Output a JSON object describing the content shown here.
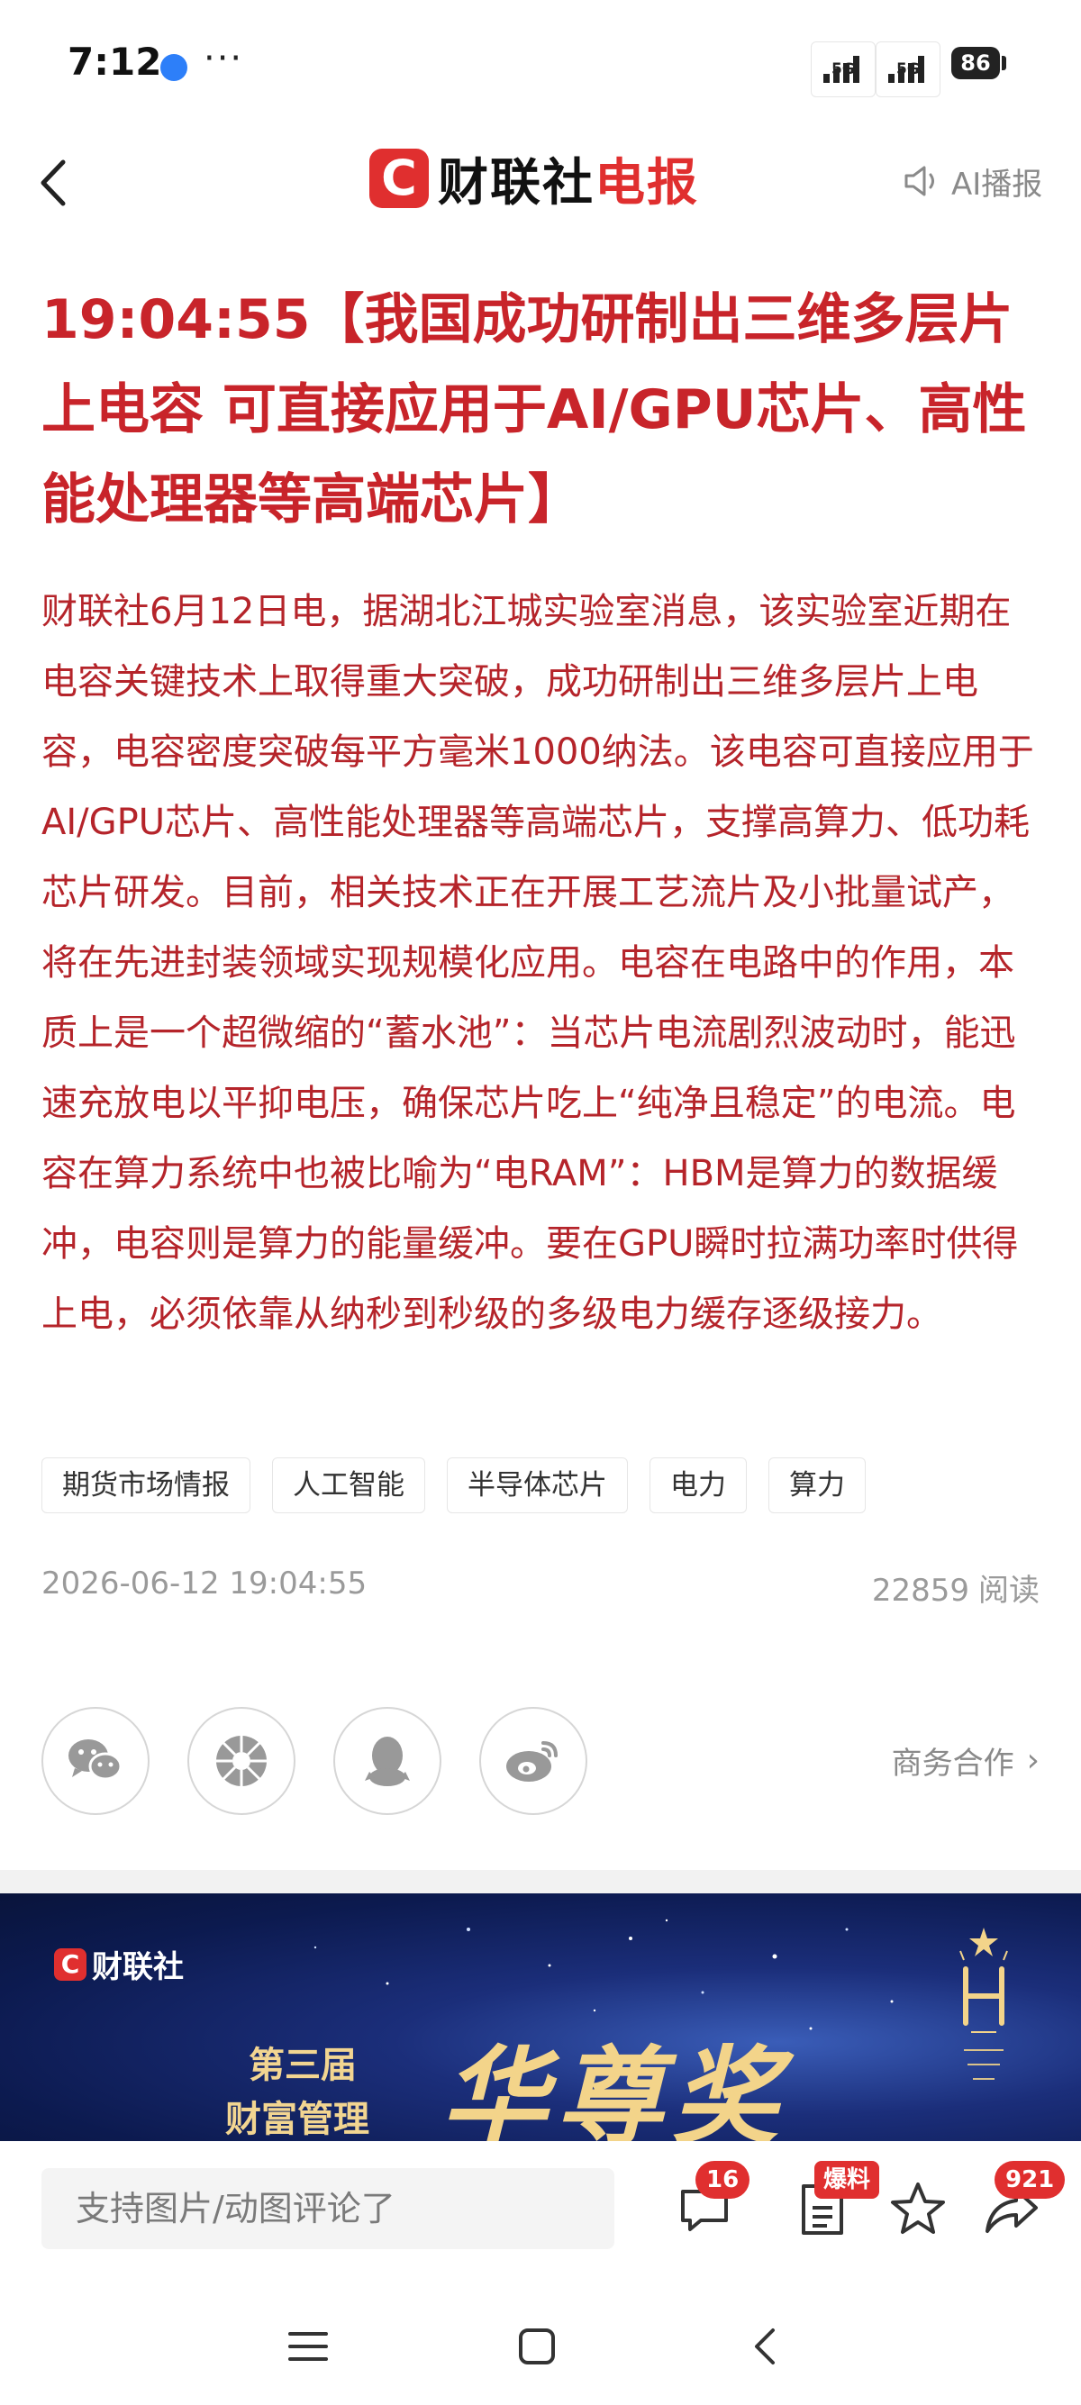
{
  "status_bar": {
    "time": "7:12",
    "dots": "···",
    "signal_1": "5G",
    "signal_2": "5G",
    "battery": "86"
  },
  "header": {
    "logo_c": "C",
    "logo_name": "财联社",
    "logo_suffix": "电报",
    "ai_broadcast": "AI播报"
  },
  "article": {
    "headline": "19:04:55【我国成功研制出三维多层片上电容 可直接应用于AI/GPU芯片、高性能处理器等高端芯片】",
    "body": "财联社6月12日电，据湖北江城实验室消息，该实验室近期在电容关键技术上取得重大突破，成功研制出三维多层片上电容，电容密度突破每平方毫米1000纳法。该电容可直接应用于AI/GPU芯片、高性能处理器等高端芯片，支撑高算力、低功耗芯片研发。目前，相关技术正在开展工艺流片及小批量试产，将在先进封装领域实现规模化应用。电容在电路中的作用，本质上是一个超微缩的“蓄水池”：当芯片电流剧烈波动时，能迅速充放电以平抑电压，确保芯片吃上“纯净且稳定”的电流。电容在算力系统中也被比喻为“电RAM”：HBM是算力的数据缓冲，电容则是算力的能量缓冲。要在GPU瞬时拉满功率时供得上电，必须依靠从纳秒到秒级的多级电力缓存逐级接力。",
    "tags": [
      "期货市场情报",
      "人工智能",
      "半导体芯片",
      "电力",
      "算力"
    ],
    "date": "2026-06-12 19:04:55",
    "reads": "22859",
    "reads_label": "阅读",
    "business": "商务合作"
  },
  "share": [
    "wechat-icon",
    "moments-icon",
    "qq-icon",
    "weibo-icon"
  ],
  "banner": {
    "logo_c": "C",
    "logo_name": "财联社",
    "edition": "第三届",
    "subtitle": "财富管理",
    "award": "华尊奖"
  },
  "comment_bar": {
    "placeholder": "支持图片/动图评论了",
    "comment_count": "16",
    "report_label": "爆料",
    "share_count": "921"
  },
  "colors": {
    "brand_red": "#e02f2f",
    "headline_red": "#c8242a",
    "body_red": "#b5242a"
  }
}
